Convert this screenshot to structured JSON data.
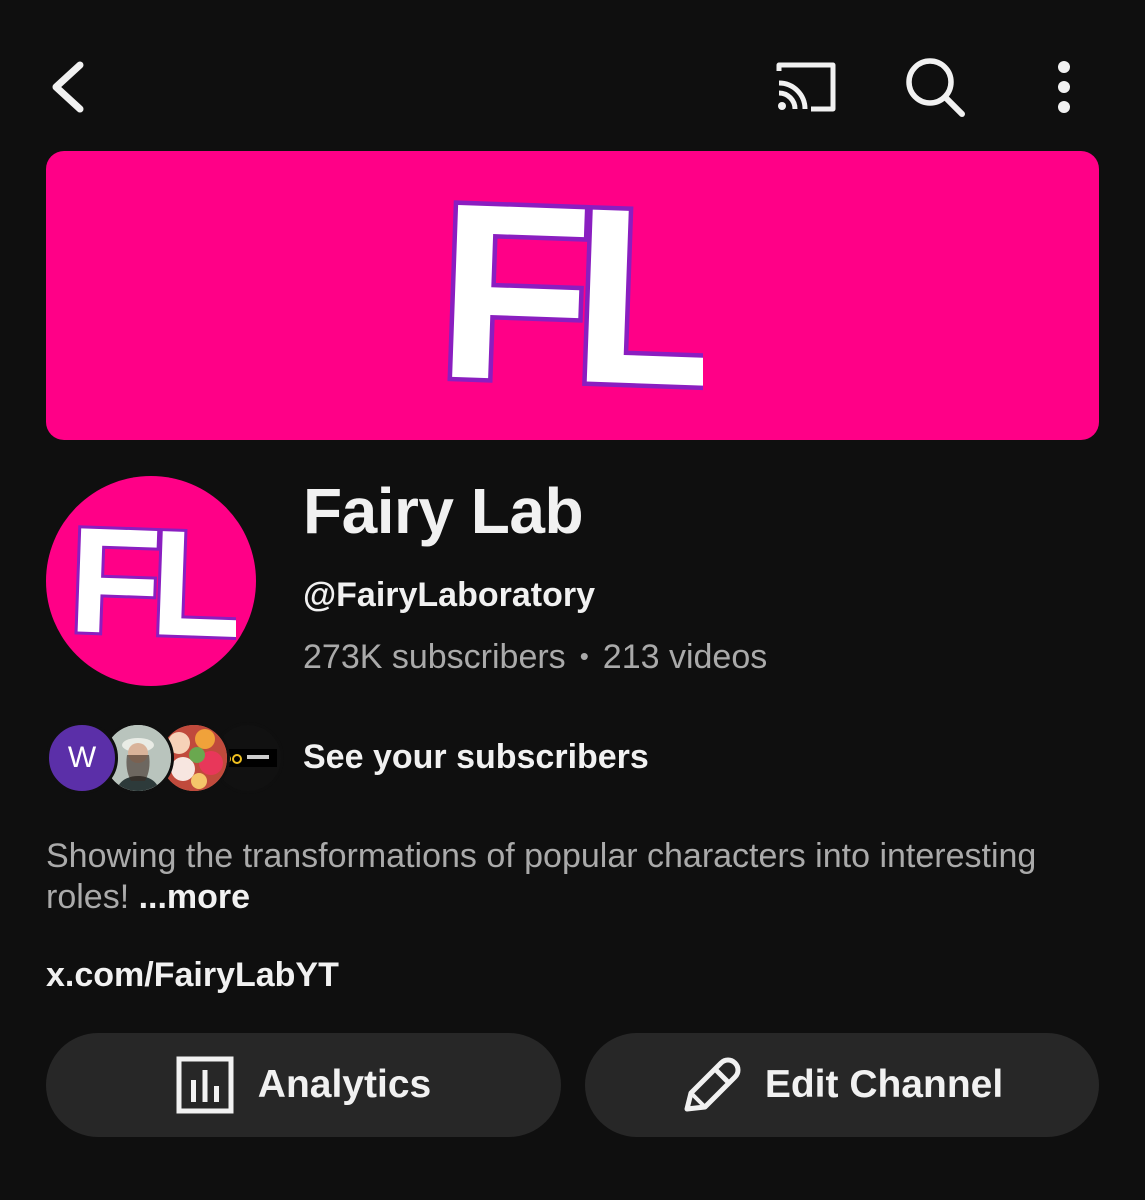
{
  "topbar": {
    "back_icon": "chevron-left-icon",
    "cast_icon": "cast-icon",
    "search_icon": "search-icon",
    "more_icon": "more-vertical-icon"
  },
  "banner": {
    "logo_text": "FL",
    "background": "#ff0087",
    "logo_color": "#8a1ec0"
  },
  "channel": {
    "avatar_text": "FL",
    "name": "Fairy Lab",
    "handle": "@FairyLaboratory",
    "subscribers": "273K subscribers",
    "separator": "•",
    "videos": "213 videos"
  },
  "subscribers_row": {
    "first_avatar_letter": "W",
    "label": "See your subscribers"
  },
  "description": {
    "text": "Showing the transformations of popular characters into interesting roles! ",
    "more_label": "...more"
  },
  "link": {
    "text": "x.com/FairyLabYT"
  },
  "actions": {
    "analytics_label": "Analytics",
    "analytics_icon": "analytics-bar-chart-icon",
    "edit_label": "Edit Channel",
    "edit_icon": "pencil-icon"
  },
  "colors": {
    "background": "#0f0f0f",
    "brand_pink": "#ff0087",
    "button_bg": "#272727",
    "secondary_text": "#aaaaaa"
  }
}
